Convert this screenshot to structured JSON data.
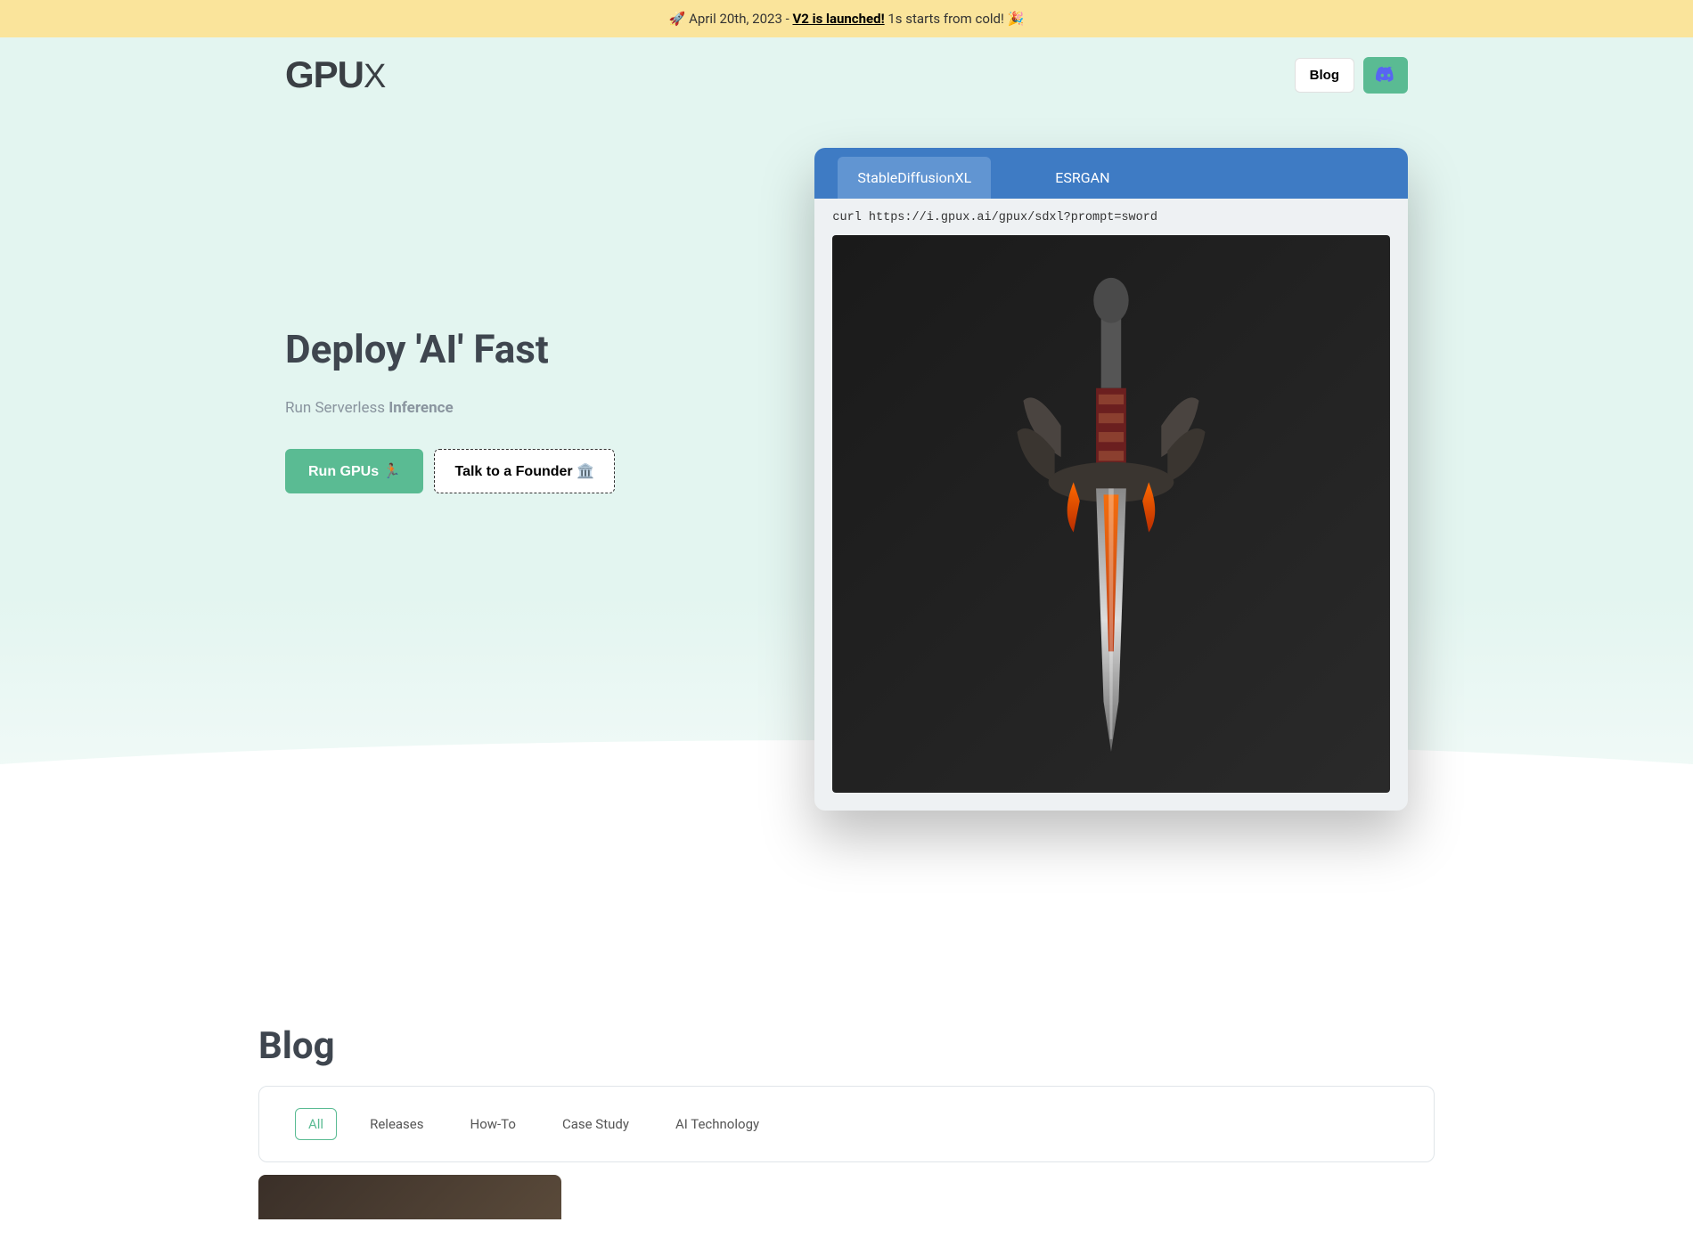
{
  "banner": {
    "emoji_left": "🚀",
    "date": "April 20th, 2023 - ",
    "link": "V2 is launched!",
    "after": " 1s starts from cold! ",
    "emoji_right": "🎉"
  },
  "nav": {
    "logo_main": "GPU",
    "logo_x": "X",
    "blog": "Blog"
  },
  "hero": {
    "title": "Deploy 'AI' Fast",
    "sub_pre": "Run Serverless ",
    "sub_bold": "Inference",
    "cta_primary": "Run GPUs 🏃🏽",
    "cta_secondary": "Talk to a Founder 🏛️"
  },
  "demo": {
    "tabs": [
      {
        "label": "StableDiffusionXL",
        "active": true
      },
      {
        "label": "ESRGAN",
        "active": false
      }
    ],
    "code": "curl https://i.gpux.ai/gpux/sdxl?prompt=sword"
  },
  "blog": {
    "title": "Blog",
    "filters": [
      {
        "label": "All",
        "active": true
      },
      {
        "label": "Releases",
        "active": false
      },
      {
        "label": "How-To",
        "active": false
      },
      {
        "label": "Case Study",
        "active": false
      },
      {
        "label": "AI Technology",
        "active": false
      }
    ]
  },
  "colors": {
    "accent": "#5abb93",
    "blue": "#3e7bc4",
    "banner": "#fae49b"
  }
}
